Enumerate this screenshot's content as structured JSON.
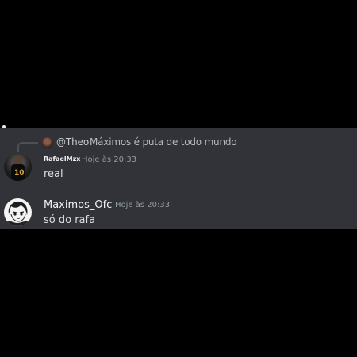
{
  "reply": {
    "mention": "@Theo",
    "text": "Máximos é puta de todo mundo",
    "avatar_icon": "user-avatar-icon"
  },
  "messages": [
    {
      "author": "RafaelMzx",
      "timestamp": "Hoje às 20:33",
      "content": "real",
      "avatar_icon": "user-avatar-icon"
    },
    {
      "author": "Maximos_Ofc",
      "timestamp": "Hoje às 20:33",
      "content": "só do rafa",
      "avatar_icon": "user-avatar-icon"
    }
  ],
  "colors": {
    "background": "#000000",
    "chat_background": "#313338",
    "text_primary": "#dbdee1",
    "text_muted": "#949ba4",
    "reply_spine": "#4e5058"
  }
}
